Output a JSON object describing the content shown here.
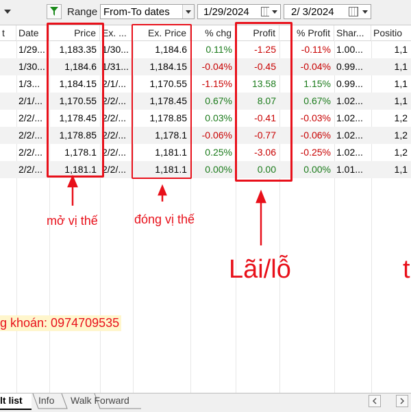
{
  "toolbar": {
    "range_label": "Range",
    "range_mode": "From-To dates",
    "from_date": "1/29/2024",
    "to_date": "2/  3/2024"
  },
  "columns": [
    "Date",
    "Price",
    "Ex. ...",
    "Ex. Price",
    "% chg",
    "Profit",
    "% Profit",
    "Shar...",
    "Positio"
  ],
  "rows": [
    {
      "date": "1/29...",
      "price": "1,183.35",
      "ex_date": "1/30...",
      "ex_price": "1,184.6",
      "chg": "0.11%",
      "profit": "-1.25",
      "pprofit": "-0.11%",
      "shares": "1.00...",
      "position": "1,1"
    },
    {
      "date": "1/30...",
      "price": "1,184.6",
      "ex_date": "1/31...",
      "ex_price": "1,184.15",
      "chg": "-0.04%",
      "profit": "-0.45",
      "pprofit": "-0.04%",
      "shares": "0.99...",
      "position": "1,1"
    },
    {
      "date": "1/3...",
      "price": "1,184.15",
      "ex_date": "2/1/...",
      "ex_price": "1,170.55",
      "chg": "-1.15%",
      "profit": "13.58",
      "pprofit": "1.15%",
      "shares": "0.99...",
      "position": "1,1"
    },
    {
      "date": "2/1/...",
      "price": "1,170.55",
      "ex_date": "2/2/...",
      "ex_price": "1,178.45",
      "chg": "0.67%",
      "profit": "8.07",
      "pprofit": "0.67%",
      "shares": "1.02...",
      "position": "1,1"
    },
    {
      "date": "2/2/...",
      "price": "1,178.45",
      "ex_date": "2/2/...",
      "ex_price": "1,178.85",
      "chg": "0.03%",
      "profit": "-0.41",
      "pprofit": "-0.03%",
      "shares": "1.02...",
      "position": "1,2"
    },
    {
      "date": "2/2/...",
      "price": "1,178.85",
      "ex_date": "2/2/...",
      "ex_price": "1,178.1",
      "chg": "-0.06%",
      "profit": "-0.77",
      "pprofit": "-0.06%",
      "shares": "1.02...",
      "position": "1,2"
    },
    {
      "date": "2/2/...",
      "price": "1,178.1",
      "ex_date": "2/2/...",
      "ex_price": "1,181.1",
      "chg": "0.25%",
      "profit": "-3.06",
      "pprofit": "-0.25%",
      "shares": "1.02...",
      "position": "1,2"
    },
    {
      "date": "2/2/...",
      "price": "1,181.1",
      "ex_date": "2/2/...",
      "ex_price": "1,181.1",
      "chg": "0.00%",
      "profit": "0.00",
      "pprofit": "0.00%",
      "shares": "1.01...",
      "position": "1,1"
    }
  ],
  "left_partial_col": "t",
  "annotations": {
    "open_label": "mở vị thế",
    "close_label": "đóng vị thế",
    "pnl_label": "Lãi/lỗ",
    "right_partial": "t",
    "contact": "g khoán: 0974709535"
  },
  "tabs": {
    "result": "lt list",
    "info": "Info",
    "walk": "Walk Forward"
  },
  "colors": {
    "annotation_red": "#e8101a",
    "negative": "#c80000",
    "positive": "#1a7a1a"
  }
}
